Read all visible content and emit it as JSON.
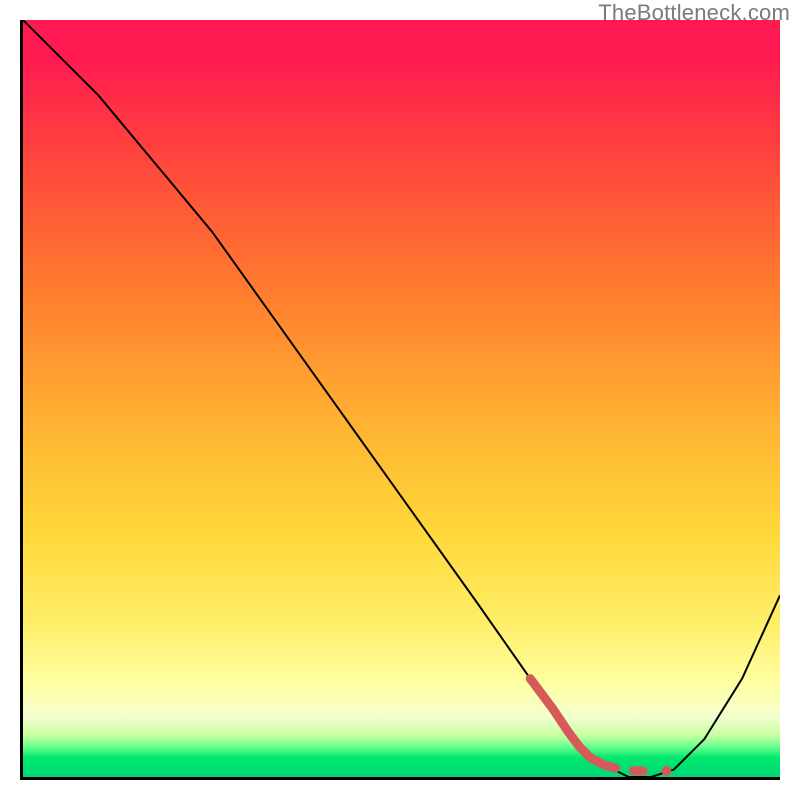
{
  "watermark": "TheBottleneck.com",
  "chart_data": {
    "type": "line",
    "title": "",
    "xlabel": "",
    "ylabel": "",
    "xlim": [
      0,
      100
    ],
    "ylim": [
      0,
      100
    ],
    "series": [
      {
        "name": "main-curve",
        "color": "#000000",
        "stroke_width": 2,
        "x": [
          0,
          10,
          20,
          25,
          30,
          40,
          50,
          60,
          67,
          72,
          76,
          80,
          83,
          86,
          90,
          95,
          100
        ],
        "y": [
          100,
          90,
          78,
          72,
          65,
          51,
          37,
          23,
          13,
          6,
          2,
          0,
          0,
          1,
          5,
          13,
          24
        ]
      },
      {
        "name": "highlight-segment",
        "color": "#d75a5a",
        "stroke_width": 9,
        "dash": "none-then-dash",
        "x": [
          67,
          70,
          72,
          73.5,
          75,
          77,
          79,
          81,
          83,
          85
        ],
        "y": [
          13,
          9,
          6,
          4,
          2.5,
          1.5,
          1,
          0.8,
          0.8,
          0.8
        ]
      }
    ],
    "gradient_stops": [
      {
        "pos": 0.0,
        "color": "#ff1a52"
      },
      {
        "pos": 0.15,
        "color": "#ff3b40"
      },
      {
        "pos": 0.35,
        "color": "#ff7a2e"
      },
      {
        "pos": 0.55,
        "color": "#ffb733"
      },
      {
        "pos": 0.68,
        "color": "#ffd83a"
      },
      {
        "pos": 0.8,
        "color": "#ffef6a"
      },
      {
        "pos": 0.92,
        "color": "#f4ffd0"
      },
      {
        "pos": 0.96,
        "color": "#67ff8f"
      },
      {
        "pos": 1.0,
        "color": "#00d877"
      }
    ]
  }
}
